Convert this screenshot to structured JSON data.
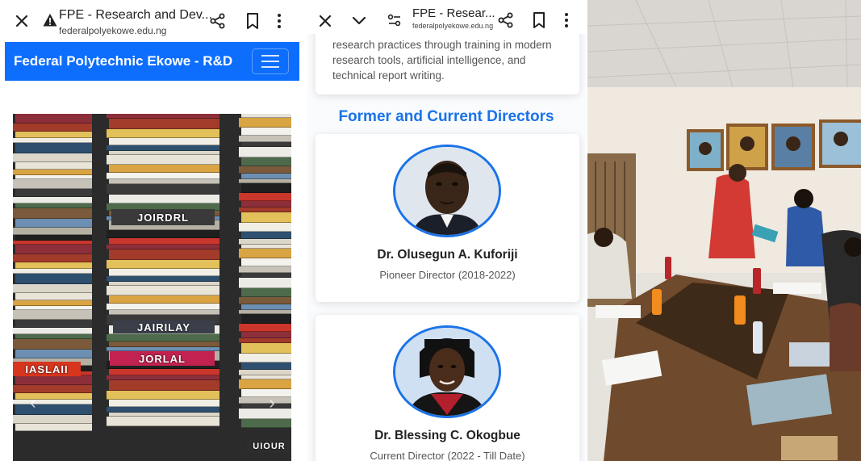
{
  "panel1": {
    "tab_title": "FPE - Research and Dev...",
    "url": "federalpolyekowe.edu.ng",
    "brand": "Federal Polytechnic Ekowe - R&D",
    "carousel_spines": [
      "JOIRDRL",
      "JAIRILAY",
      "JORLAL",
      "IASLAII",
      "UIOUR"
    ]
  },
  "panel2": {
    "tab_title": "FPE - Resear...",
    "url": "federalpolyekowe.edu.ng",
    "intro_text": "research practices through training in modern research tools, artificial intelligence, and technical report writing.",
    "section_title": "Former and Current Directors",
    "directors": [
      {
        "name": "Dr. Olusegun A. Kuforiji",
        "role": "Pioneer Director (2018-2022)"
      },
      {
        "name": "Dr. Blessing C. Okogbue",
        "role": "Current Director (2022 - Till Date)"
      }
    ]
  },
  "colors": {
    "navbar": "#0d6efd",
    "heading": "#1a73e8"
  }
}
